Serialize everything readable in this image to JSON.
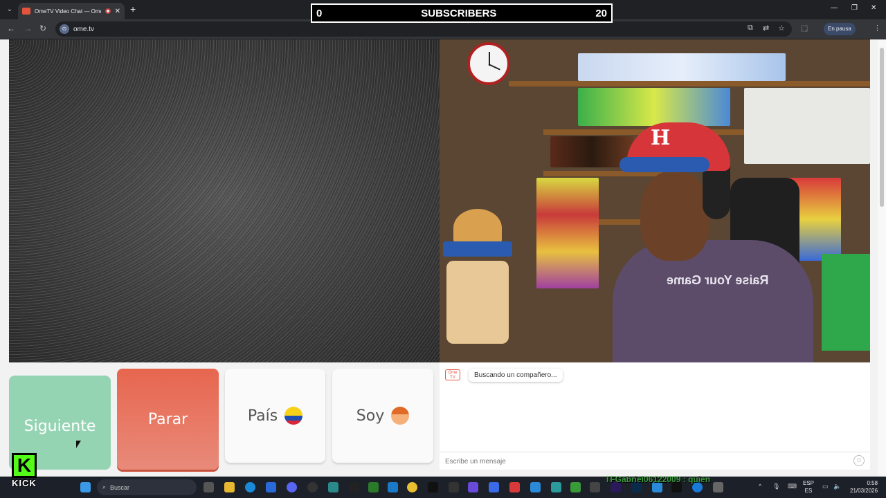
{
  "browser": {
    "tab_title": "OmeTV Video Chat — Ome",
    "url": "ome.tv",
    "profile_status": "En pausa"
  },
  "overlay": {
    "left_count": "0",
    "label": "SUBSCRIBERS",
    "right_count": "20"
  },
  "buttons": {
    "next": "Siguiente",
    "stop": "Parar",
    "country": "País",
    "gender": "Soy"
  },
  "chat": {
    "logo_text": "Ome TV",
    "status_message": "Buscando un compañero...",
    "input_placeholder": "Escribe un mensaje"
  },
  "video": {
    "shirt_text": "Raise Your Game",
    "cap_logo": "H"
  },
  "stream": {
    "kick_word": "KICK",
    "chat_line": "TFGabriel06122009 : quien"
  },
  "taskbar": {
    "search_placeholder": "Buscar",
    "lang_top": "ESP",
    "lang_bottom": "ES",
    "time": "0:58",
    "date": "21/03/2026"
  },
  "colors": {
    "next_button": "#95d4b3",
    "stop_button": "#e7664e",
    "kick_green": "#53fc18"
  }
}
